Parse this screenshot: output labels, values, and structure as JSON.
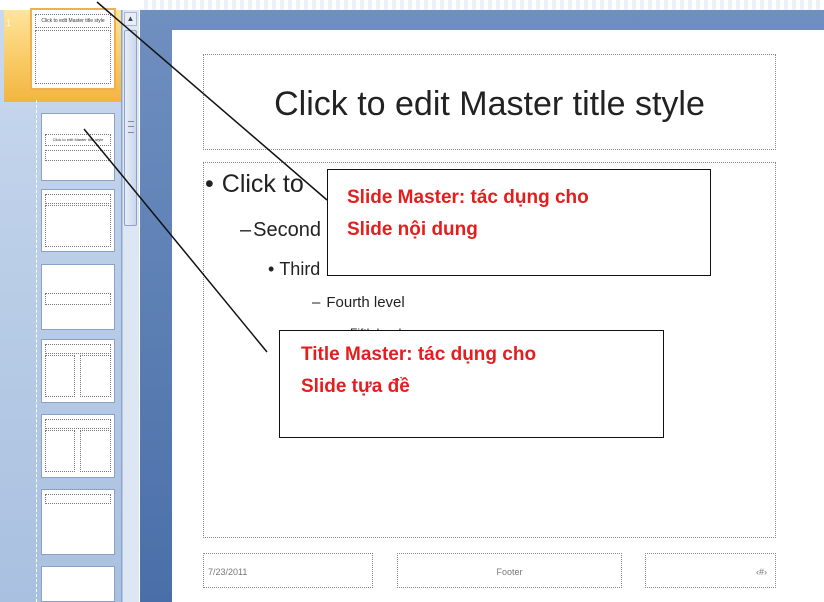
{
  "thumbnails": {
    "slide_number": "1",
    "master_thumb_title": "Click to edit Master title style",
    "layout_thumb_title": "Click to edit Master title style"
  },
  "slide": {
    "title": "Click to edit Master title style",
    "levels": {
      "first": "Click to",
      "second": "Second",
      "third": "Third",
      "fourth": "Fourth level",
      "fifth": "Fifth level"
    },
    "date": "7/23/2011",
    "footer": "Footer",
    "number": "‹#›"
  },
  "callouts": {
    "master": {
      "line1": "Slide Master: tác dụng cho",
      "line2": "Slide nội dung"
    },
    "title": {
      "line1": "Title Master: tác dụng cho",
      "line2": "Slide tựa đề"
    }
  },
  "colors": {
    "callout_text": "#e41e1e",
    "thumb_highlight": "#f8c860",
    "pane_bg": "#b8cce6"
  }
}
